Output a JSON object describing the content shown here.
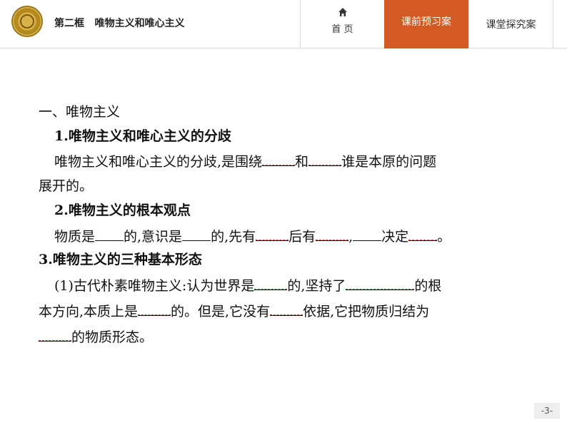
{
  "header": {
    "title": "第二框   唯物主义和唯心主义",
    "home_label": "首  页",
    "tab_active": "课前预习案",
    "tab_other": "课堂探究案"
  },
  "content": {
    "heading1": "一、唯物主义",
    "sec1_title": "1.唯物主义和唯心主义的分歧",
    "sec1_line1_a": "唯物主义和唯心主义的分歧,是围绕",
    "sec1_line1_b": "和",
    "sec1_line1_c": "谁是本原的问题",
    "sec1_line2": "展开的。",
    "sec2_title": "2.唯物主义的根本观点",
    "sec2_a": "物质是",
    "sec2_b": "的,意识是",
    "sec2_c": "的,先有",
    "sec2_d": "后有",
    "sec2_e": ",",
    "sec2_f": "决定",
    "sec2_g": "。",
    "sec3_title": "3.唯物主义的三种基本形态",
    "sec3_l1_a": "(1)古代朴素唯物主义:认为世界是",
    "sec3_l1_b": "的,坚持了",
    "sec3_l1_c": "的根",
    "sec3_l2_a": "本方向,本质上是",
    "sec3_l2_b": "的。但是,它没有",
    "sec3_l2_c": "依据,它把物质归结为",
    "sec3_l3": "的物质形态。"
  },
  "page": {
    "number": "-3-"
  }
}
